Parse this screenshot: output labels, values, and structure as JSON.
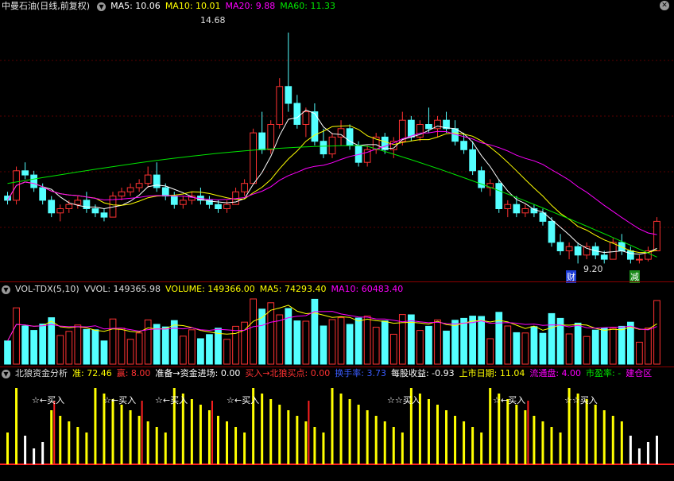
{
  "price_header": {
    "title": "中曼石油(日线,前复权)",
    "ma5": "MA5: 10.06",
    "ma10": "MA10: 10.01",
    "ma20": "MA20: 9.88",
    "ma60": "MA60: 11.33"
  },
  "price_annotations": {
    "high": "14.68",
    "low": "9.20",
    "badge_cai": "财",
    "badge_jian": "减"
  },
  "vol_header": {
    "title": "VOL-TDX(5,10)",
    "vvol": "VVOL: 149365.98",
    "volume": "VOLUME: 149366.00",
    "ma5": "MA5: 74293.40",
    "ma10": "MA10: 60483.40"
  },
  "ind_header": {
    "title": "北狼资金分析",
    "zhun": "准: 72.46",
    "yun": "赢: 8.00",
    "ready": "准备→资金进场: 0.00",
    "buy": "买入→北狼买点: 0.00",
    "turnover": "换手率: 3.73",
    "eps": "每股收益: -0.93",
    "ipo": "上市日期: 11.04",
    "float": "流通盘: 4.00",
    "pe": "市盈率: -",
    "build": "建仓区"
  },
  "buy_labels": [
    "☆←买入",
    "☆←买入",
    "☆←买入",
    "☆←买入",
    "☆☆买入",
    "☆←买入",
    "☆☆买入"
  ],
  "colors": {
    "up": "#ff3232",
    "down": "#54ffff",
    "ma5": "#ffffff",
    "ma10": "#ffff00",
    "ma20": "#ff00ff",
    "ma60": "#00e600",
    "yellow": "#ffff00",
    "red": "#ff2020"
  },
  "chart_data": {
    "type": "candlestick",
    "price_axis": [
      9.0,
      15.0
    ],
    "candles": [
      [
        10.8,
        10.9,
        10.6,
        10.7
      ],
      [
        10.7,
        11.5,
        10.6,
        11.4
      ],
      [
        11.4,
        11.6,
        11.2,
        11.3
      ],
      [
        11.3,
        11.4,
        10.9,
        11.0
      ],
      [
        11.0,
        11.1,
        10.6,
        10.7
      ],
      [
        10.7,
        10.8,
        10.3,
        10.4
      ],
      [
        10.4,
        10.6,
        10.2,
        10.5
      ],
      [
        10.5,
        10.7,
        10.4,
        10.6
      ],
      [
        10.6,
        10.8,
        10.5,
        10.7
      ],
      [
        10.7,
        10.9,
        10.4,
        10.5
      ],
      [
        10.5,
        10.6,
        10.3,
        10.4
      ],
      [
        10.4,
        10.5,
        10.2,
        10.3
      ],
      [
        10.3,
        10.9,
        10.3,
        10.8
      ],
      [
        10.8,
        11.0,
        10.7,
        10.9
      ],
      [
        10.9,
        11.1,
        10.8,
        11.0
      ],
      [
        11.0,
        11.2,
        10.9,
        11.1
      ],
      [
        11.1,
        11.5,
        11.0,
        11.3
      ],
      [
        11.3,
        11.6,
        10.9,
        11.0
      ],
      [
        11.0,
        11.1,
        10.7,
        10.8
      ],
      [
        10.8,
        10.9,
        10.5,
        10.6
      ],
      [
        10.6,
        10.8,
        10.5,
        10.7
      ],
      [
        10.7,
        10.9,
        10.6,
        10.8
      ],
      [
        10.8,
        11.0,
        10.6,
        10.7
      ],
      [
        10.7,
        10.8,
        10.5,
        10.6
      ],
      [
        10.6,
        10.7,
        10.4,
        10.5
      ],
      [
        10.5,
        10.7,
        10.4,
        10.6
      ],
      [
        10.6,
        11.0,
        10.6,
        10.9
      ],
      [
        10.9,
        11.2,
        10.8,
        11.1
      ],
      [
        11.1,
        12.4,
        11.1,
        12.3
      ],
      [
        12.3,
        12.8,
        11.8,
        11.9
      ],
      [
        11.9,
        12.6,
        11.8,
        12.5
      ],
      [
        12.5,
        13.6,
        12.4,
        13.4
      ],
      [
        13.4,
        14.68,
        12.8,
        13.0
      ],
      [
        13.0,
        13.2,
        12.4,
        12.5
      ],
      [
        12.5,
        12.9,
        12.2,
        12.8
      ],
      [
        12.8,
        13.0,
        12.0,
        12.1
      ],
      [
        12.1,
        12.4,
        11.7,
        11.8
      ],
      [
        11.8,
        12.3,
        11.7,
        12.2
      ],
      [
        12.2,
        12.6,
        12.0,
        12.4
      ],
      [
        12.4,
        12.5,
        11.9,
        12.0
      ],
      [
        12.0,
        12.1,
        11.5,
        11.6
      ],
      [
        11.6,
        12.0,
        11.5,
        11.9
      ],
      [
        11.9,
        12.3,
        11.8,
        12.2
      ],
      [
        12.2,
        12.3,
        11.8,
        11.9
      ],
      [
        11.9,
        12.2,
        11.7,
        12.1
      ],
      [
        12.1,
        12.8,
        12.0,
        12.6
      ],
      [
        12.6,
        12.7,
        12.1,
        12.2
      ],
      [
        12.2,
        12.6,
        12.1,
        12.5
      ],
      [
        12.5,
        12.9,
        12.3,
        12.4
      ],
      [
        12.4,
        12.7,
        12.2,
        12.6
      ],
      [
        12.6,
        12.8,
        12.3,
        12.4
      ],
      [
        12.4,
        12.6,
        12.0,
        12.1
      ],
      [
        12.1,
        12.3,
        11.8,
        11.9
      ],
      [
        11.9,
        12.1,
        11.3,
        11.4
      ],
      [
        11.4,
        11.5,
        10.9,
        11.0
      ],
      [
        11.0,
        11.2,
        10.8,
        11.1
      ],
      [
        11.1,
        11.2,
        10.4,
        10.5
      ],
      [
        10.5,
        10.7,
        10.3,
        10.6
      ],
      [
        10.6,
        10.8,
        10.3,
        10.4
      ],
      [
        10.4,
        10.6,
        10.3,
        10.5
      ],
      [
        10.5,
        10.6,
        10.3,
        10.4
      ],
      [
        10.4,
        10.5,
        10.1,
        10.2
      ],
      [
        10.2,
        10.3,
        9.6,
        9.7
      ],
      [
        9.7,
        9.9,
        9.4,
        9.5
      ],
      [
        9.5,
        9.7,
        9.3,
        9.6
      ],
      [
        9.6,
        9.7,
        9.2,
        9.4
      ],
      [
        9.4,
        9.7,
        9.3,
        9.6
      ],
      [
        9.6,
        9.7,
        9.3,
        9.4
      ],
      [
        9.4,
        9.5,
        9.2,
        9.3
      ],
      [
        9.3,
        9.8,
        9.3,
        9.7
      ],
      [
        9.7,
        9.9,
        9.4,
        9.5
      ],
      [
        9.5,
        9.6,
        9.2,
        9.3
      ],
      [
        9.3,
        9.4,
        9.2,
        9.3
      ],
      [
        9.3,
        9.6,
        9.25,
        9.5
      ],
      [
        9.5,
        10.3,
        9.5,
        10.2
      ]
    ]
  }
}
